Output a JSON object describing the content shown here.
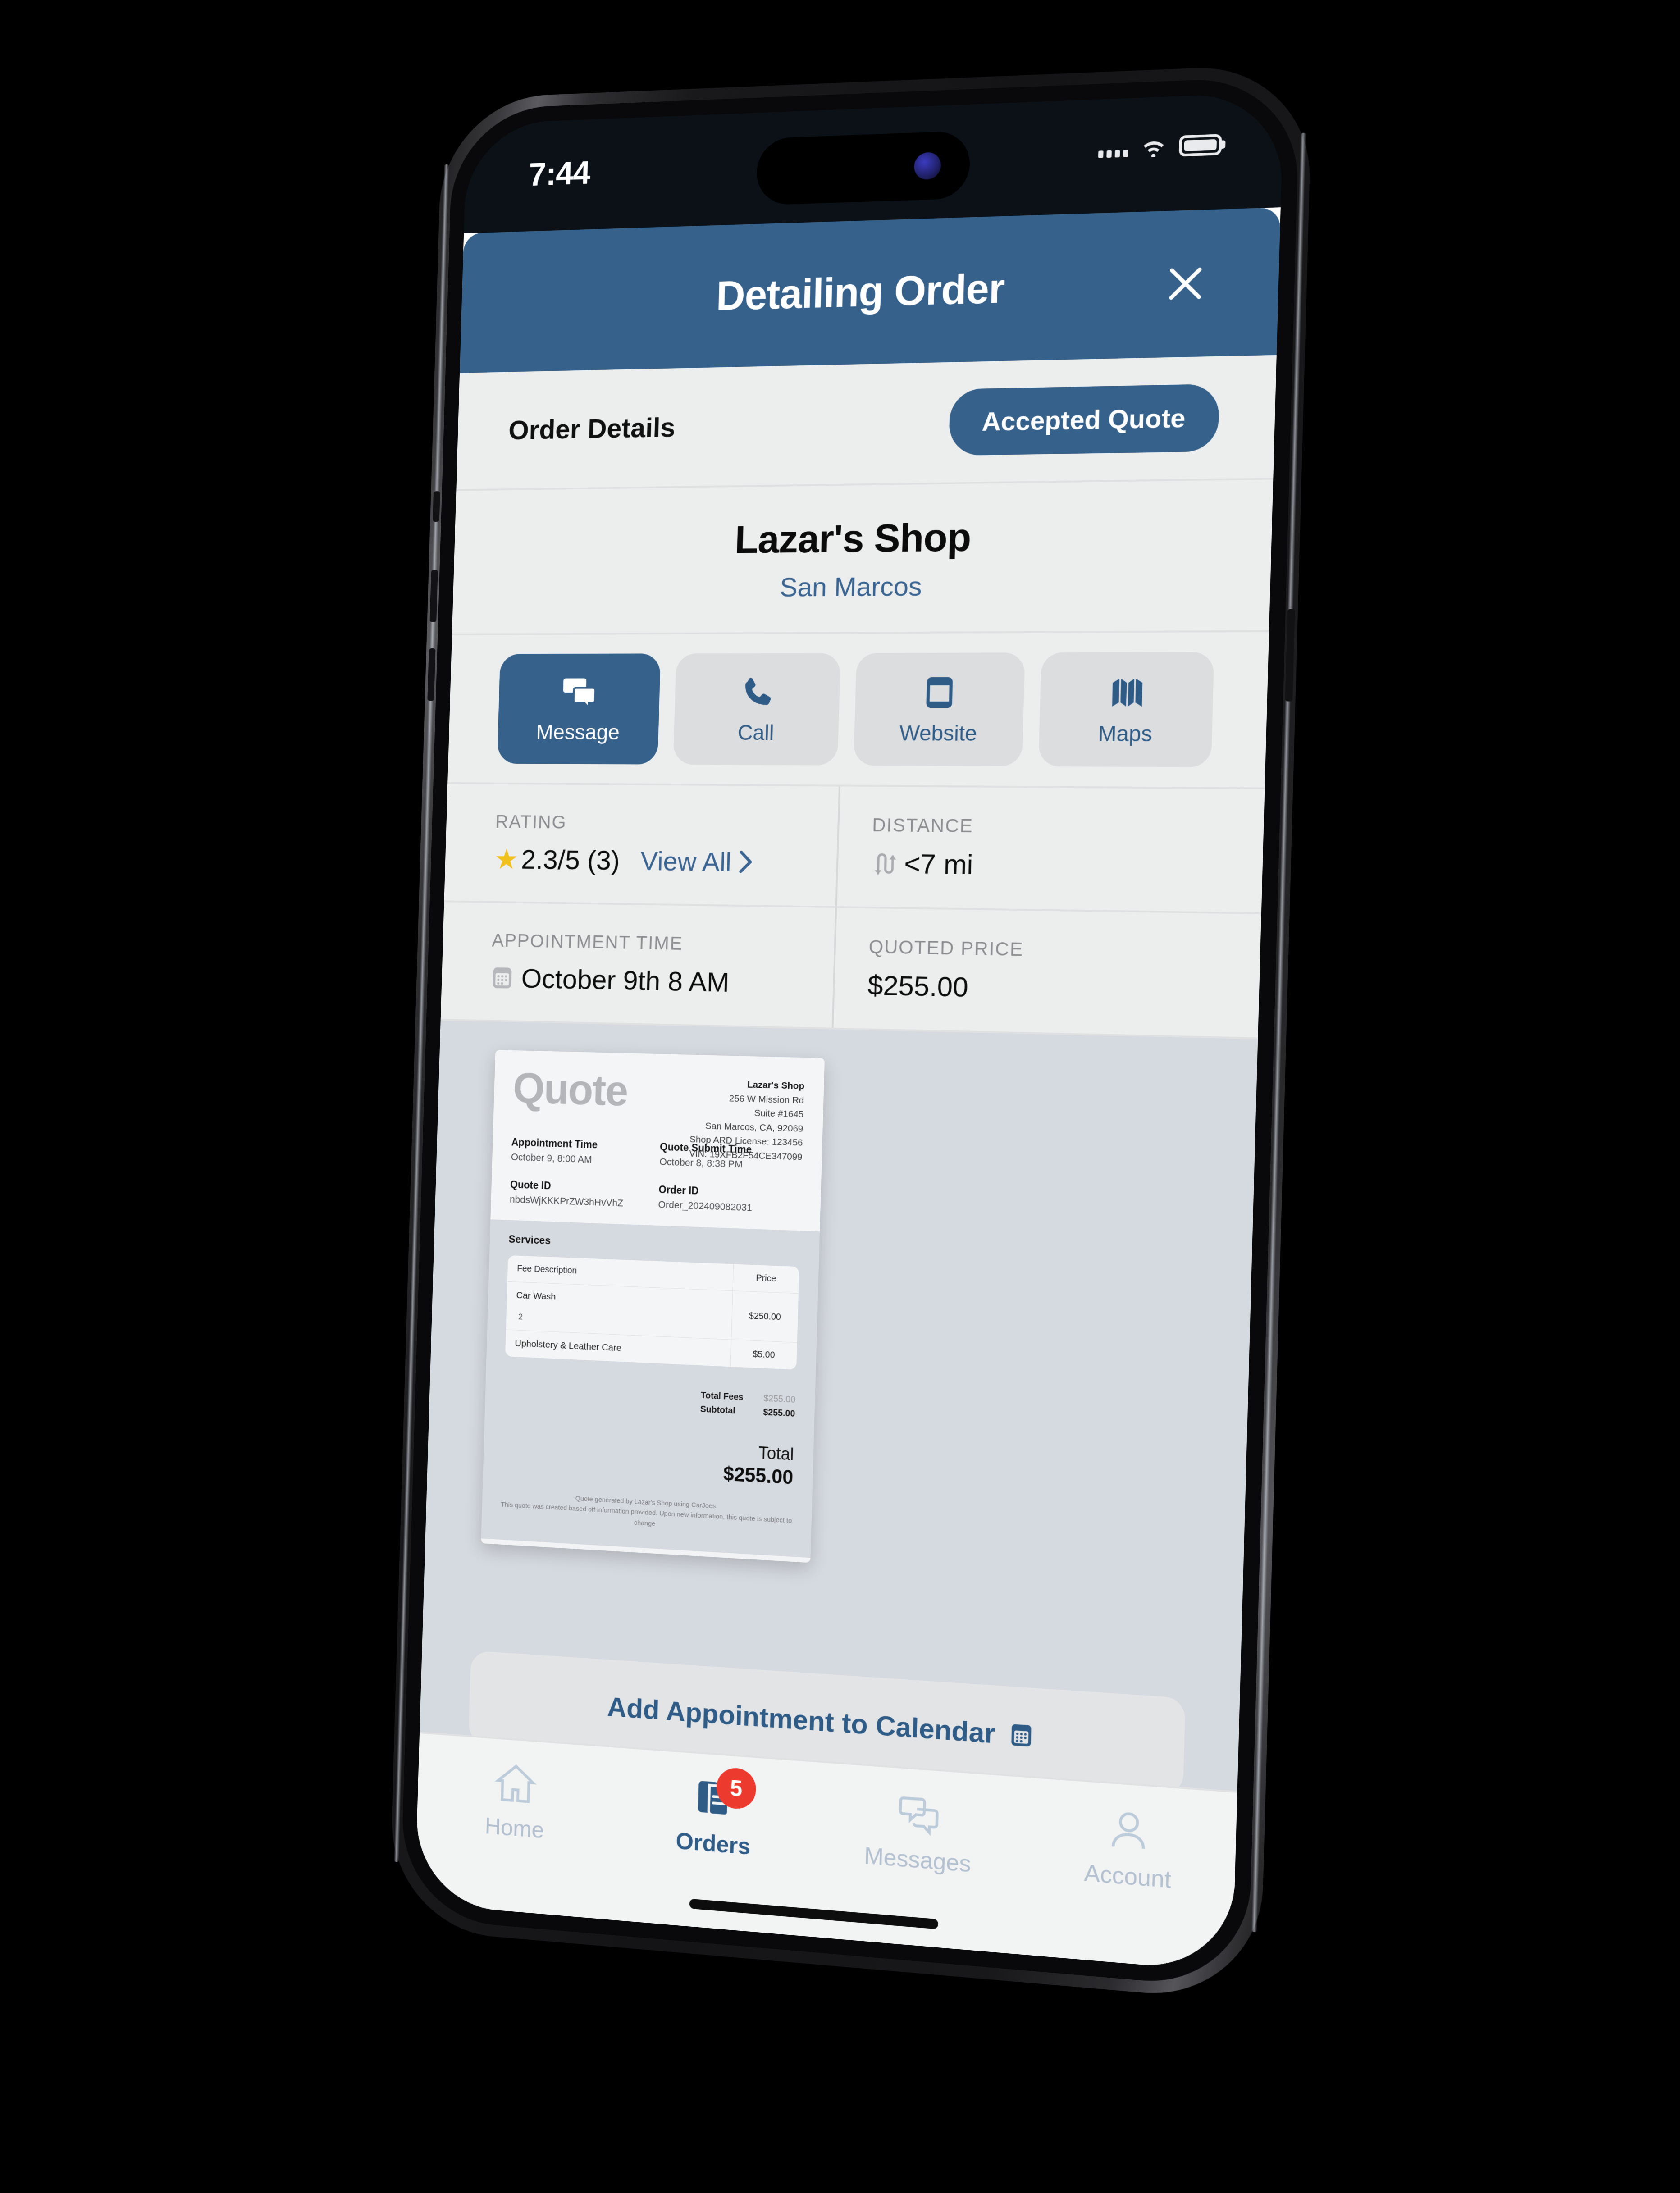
{
  "status_bar": {
    "time": "7:44",
    "icons": [
      "signal-bars-icon",
      "wifi-icon",
      "battery-icon"
    ]
  },
  "header": {
    "title": "Detailing Order",
    "close_icon": "close-icon"
  },
  "tab_row": {
    "order_details_label": "Order Details",
    "quote_status": "Accepted Quote"
  },
  "shop": {
    "name": "Lazar's Shop",
    "city": "San Marcos"
  },
  "actions": [
    {
      "label": "Message",
      "icon": "message-icon",
      "primary": true
    },
    {
      "label": "Call",
      "icon": "phone-icon",
      "primary": false
    },
    {
      "label": "Website",
      "icon": "browser-icon",
      "primary": false
    },
    {
      "label": "Maps",
      "icon": "map-icon",
      "primary": false
    }
  ],
  "info": {
    "rating_label": "RATING",
    "rating_value": "2.3/5 (3)",
    "rating_star": "★",
    "view_all_label": "View All",
    "distance_label": "DISTANCE",
    "distance_value": "<7 mi",
    "appointment_label": "APPOINTMENT TIME",
    "appointment_value": "October 9th 8 AM",
    "price_label": "QUOTED PRICE",
    "price_value": "$255.00"
  },
  "quote_document": {
    "title": "Quote",
    "shop_name": "Lazar's Shop",
    "shop_address_1": "256 W Mission Rd",
    "shop_address_2": "Suite #1645",
    "shop_address_3": "San Marcos, CA, 92069",
    "shop_license": "Shop ARD License: 123456",
    "vin": "VIN: 19XFB2F54CE347099",
    "appointment_time_label": "Appointment Time",
    "appointment_time_value": "October 9, 8:00 AM",
    "quote_submit_label": "Quote Submit Time",
    "quote_submit_value": "October 8, 8:38 PM",
    "quote_id_label": "Quote ID",
    "quote_id_value": "nbdsWjKKKPrZW3hHvVhZ",
    "order_id_label": "Order ID",
    "order_id_value": "Order_202409082031",
    "services_label": "Services",
    "col_description": "Fee Description",
    "col_price": "Price",
    "rows": [
      {
        "description": "Car Wash",
        "qty": "2",
        "price": "$250.00"
      },
      {
        "description": "Upholstery & Leather Care",
        "qty": "",
        "price": "$5.00"
      }
    ],
    "total_fees_label": "Total Fees",
    "total_fees_value": "$255.00",
    "subtotal_label": "Subtotal",
    "subtotal_value": "$255.00",
    "grand_total_label": "Total",
    "grand_total_value": "$255.00",
    "footer_line_1": "Quote generated by Lazar's Shop using CarJoes",
    "footer_line_2": "This quote was created based off information provided. Upon new information, this quote is subject to change"
  },
  "calendar_cta": {
    "label": "Add Appointment to Calendar",
    "icon": "calendar-icon"
  },
  "tab_bar": [
    {
      "label": "Home",
      "icon": "home-icon",
      "active": false,
      "badge": ""
    },
    {
      "label": "Orders",
      "icon": "orders-icon",
      "active": true,
      "badge": "5"
    },
    {
      "label": "Messages",
      "icon": "messages-icon",
      "active": false,
      "badge": ""
    },
    {
      "label": "Account",
      "icon": "account-icon",
      "active": false,
      "badge": ""
    }
  ],
  "colors": {
    "brand_blue": "#35618a",
    "link_blue": "#3a6491",
    "badge_red": "#ec3b2e",
    "star_gold": "#f0c01d",
    "screen_bg": "#eceded",
    "quote_bg": "#d5dae0"
  }
}
